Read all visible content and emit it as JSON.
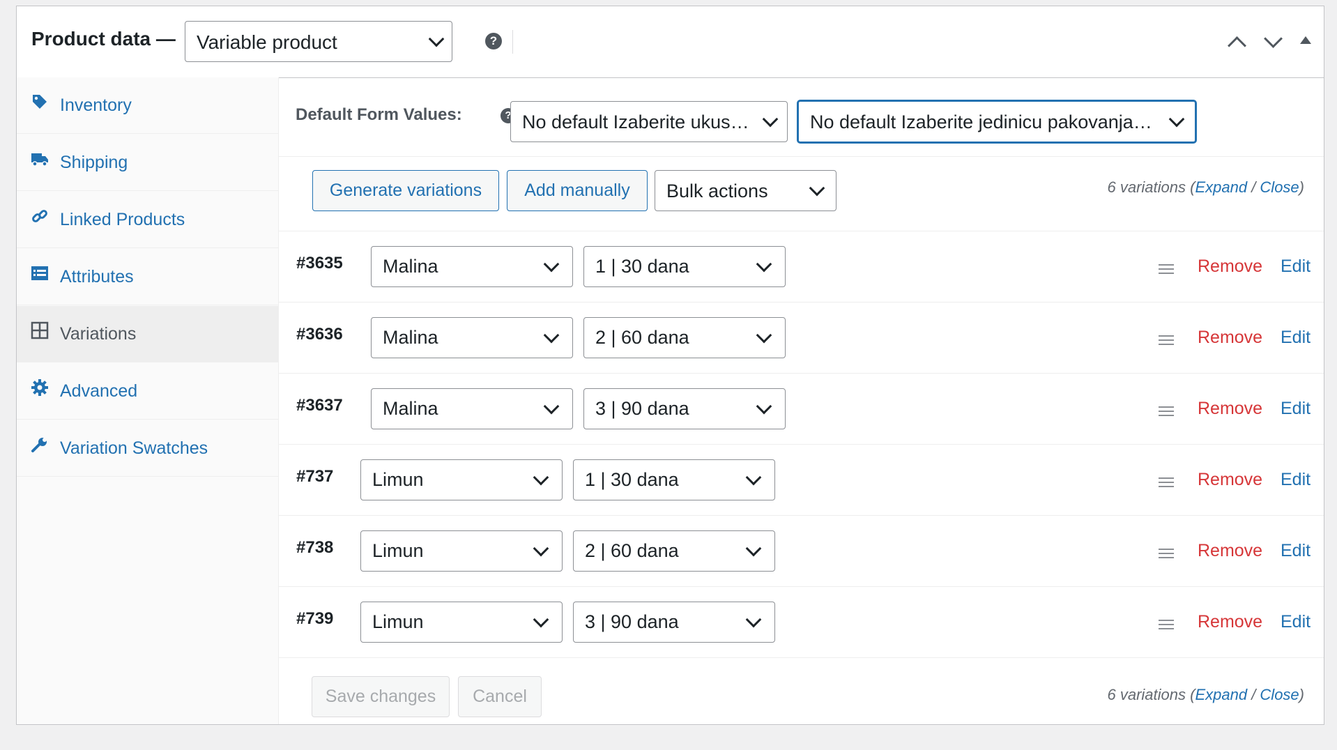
{
  "header": {
    "title": "Product data —",
    "product_type": "Variable product",
    "help_icon": "question-icon",
    "move_up_icon": "chevron-up-icon",
    "move_down_icon": "chevron-down-icon",
    "toggle_icon": "triangle-up-icon"
  },
  "sidebar": {
    "items": [
      {
        "label": "Inventory",
        "icon": "tag-icon"
      },
      {
        "label": "Shipping",
        "icon": "truck-icon"
      },
      {
        "label": "Linked Products",
        "icon": "link-icon"
      },
      {
        "label": "Attributes",
        "icon": "list-icon"
      },
      {
        "label": "Variations",
        "icon": "grid-icon",
        "active": true
      },
      {
        "label": "Advanced",
        "icon": "gear-icon"
      },
      {
        "label": "Variation Swatches",
        "icon": "wrench-icon"
      }
    ]
  },
  "defaults": {
    "label": "Default Form Values:",
    "flavor": "No default Izaberite ukus…",
    "package": "No default Izaberite jedinicu pakovanja…"
  },
  "toolbar": {
    "generate": "Generate variations",
    "add_manually": "Add manually",
    "bulk_actions": "Bulk actions",
    "count_text": "6 variations",
    "expand": "Expand",
    "close": "Close"
  },
  "variations": [
    {
      "id": "#3635",
      "flavor": "Malina",
      "package": "1 | 30 dana",
      "remove": "Remove",
      "edit": "Edit"
    },
    {
      "id": "#3636",
      "flavor": "Malina",
      "package": "2 | 60 dana",
      "remove": "Remove",
      "edit": "Edit"
    },
    {
      "id": "#3637",
      "flavor": "Malina",
      "package": "3 | 90 dana",
      "remove": "Remove",
      "edit": "Edit"
    },
    {
      "id": "#737",
      "flavor": "Limun",
      "package": "1 | 30 dana",
      "remove": "Remove",
      "edit": "Edit"
    },
    {
      "id": "#738",
      "flavor": "Limun",
      "package": "2 | 60 dana",
      "remove": "Remove",
      "edit": "Edit"
    },
    {
      "id": "#739",
      "flavor": "Limun",
      "package": "3 | 90 dana",
      "remove": "Remove",
      "edit": "Edit"
    }
  ],
  "footer": {
    "save": "Save changes",
    "cancel": "Cancel",
    "count_text": "6 variations",
    "expand": "Expand",
    "close": "Close"
  },
  "colors": {
    "accent": "#2271b1",
    "danger": "#d63638"
  }
}
